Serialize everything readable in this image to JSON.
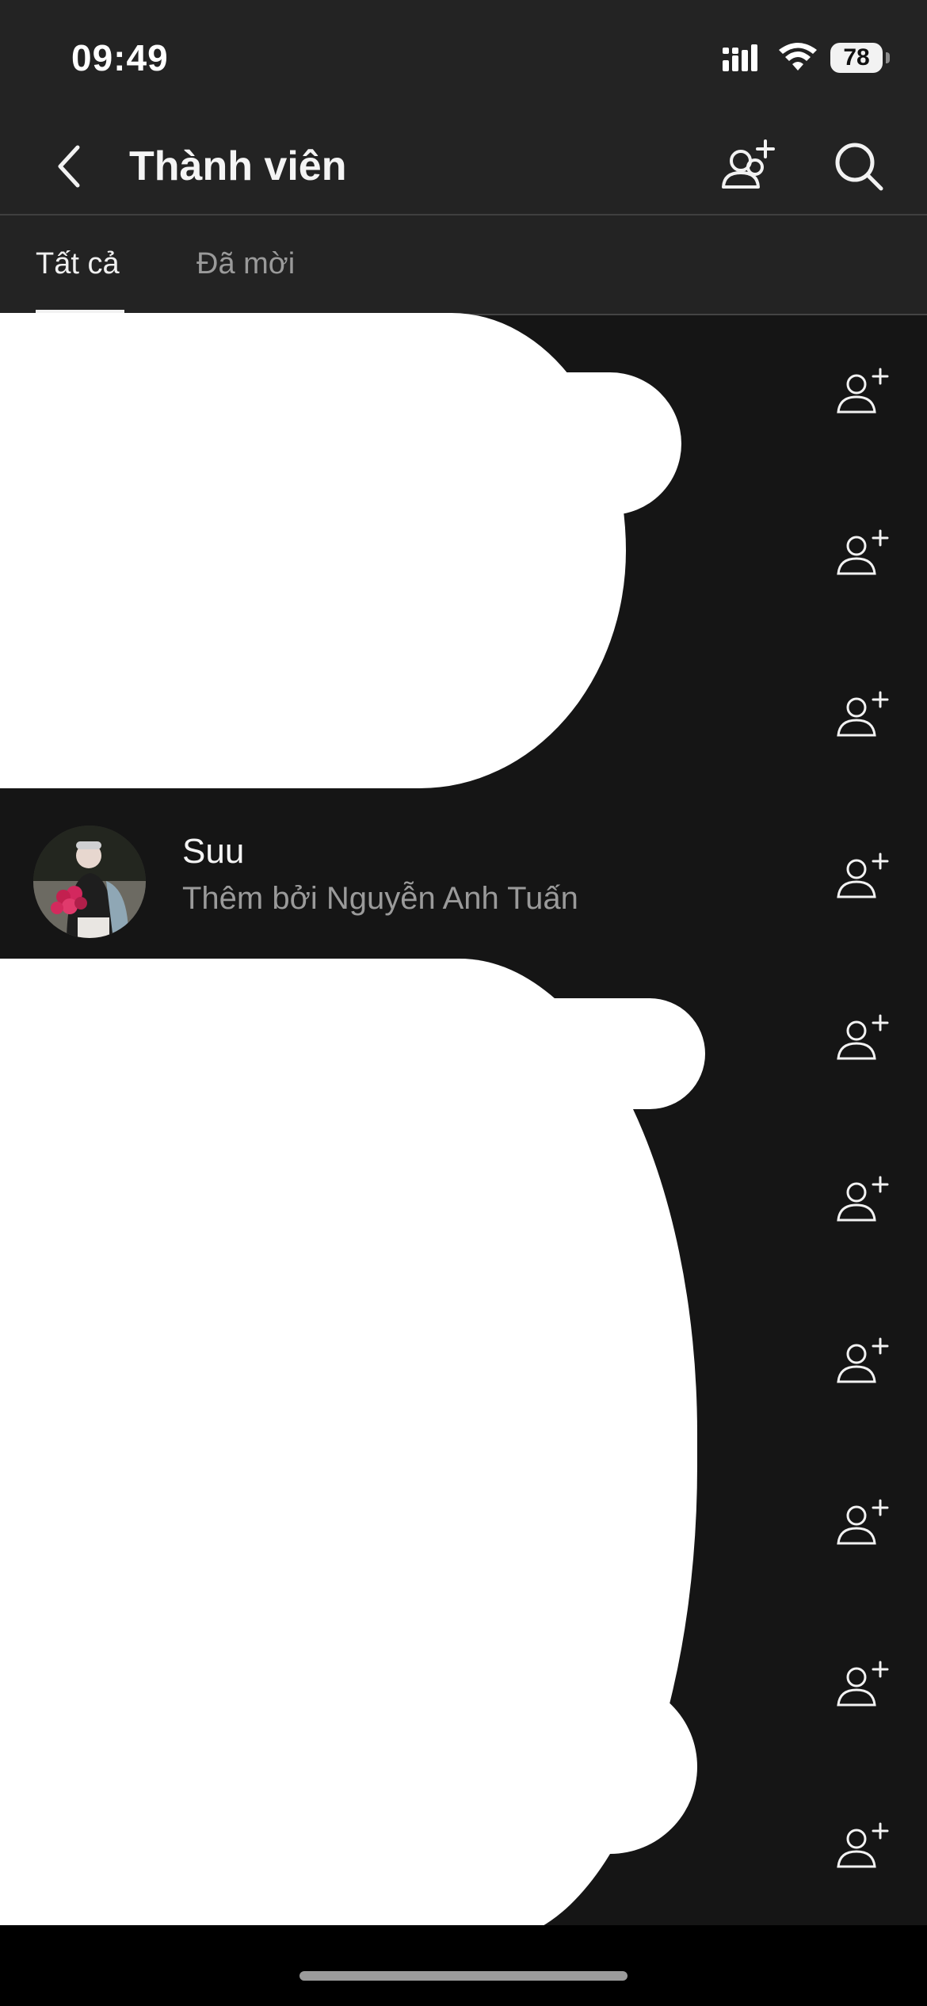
{
  "status": {
    "time": "09:49",
    "battery": "78"
  },
  "nav": {
    "title": "Thành viên"
  },
  "tabs": [
    {
      "label": "Tất cả",
      "active": true
    },
    {
      "label": "Đã mời",
      "active": false
    }
  ],
  "members": [
    {
      "name": "Suu",
      "subtitle": "Thêm bởi Nguyễn Anh Tuấn"
    }
  ],
  "colors": {
    "background": "#151515",
    "header": "#232323",
    "text": "#f2f2f2",
    "muted": "#9a9a9a"
  }
}
